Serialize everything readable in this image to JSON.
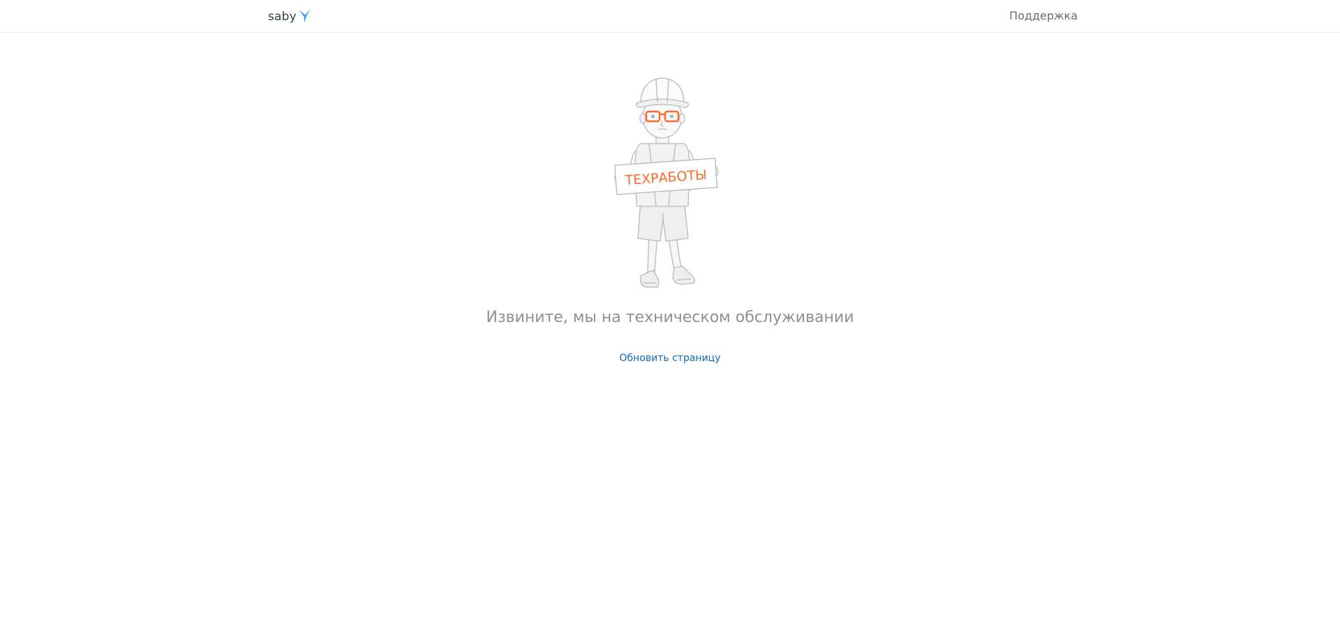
{
  "header": {
    "logo_text": "saby",
    "logo_icon": "saby-swallow-icon",
    "support_label": "Поддержка"
  },
  "illustration": {
    "icon": "maintenance-worker-illustration",
    "sign_text": "ТЕХРАБОТЫ"
  },
  "main": {
    "message": "Извините, мы на техническом обслуживании",
    "refresh_label": "Обновить страницу"
  },
  "colors": {
    "accent_orange": "#ff6a2c",
    "link_blue": "#0d6ab8",
    "logo_blue": "#1e9bff",
    "message_gray": "#8f8f8f"
  }
}
